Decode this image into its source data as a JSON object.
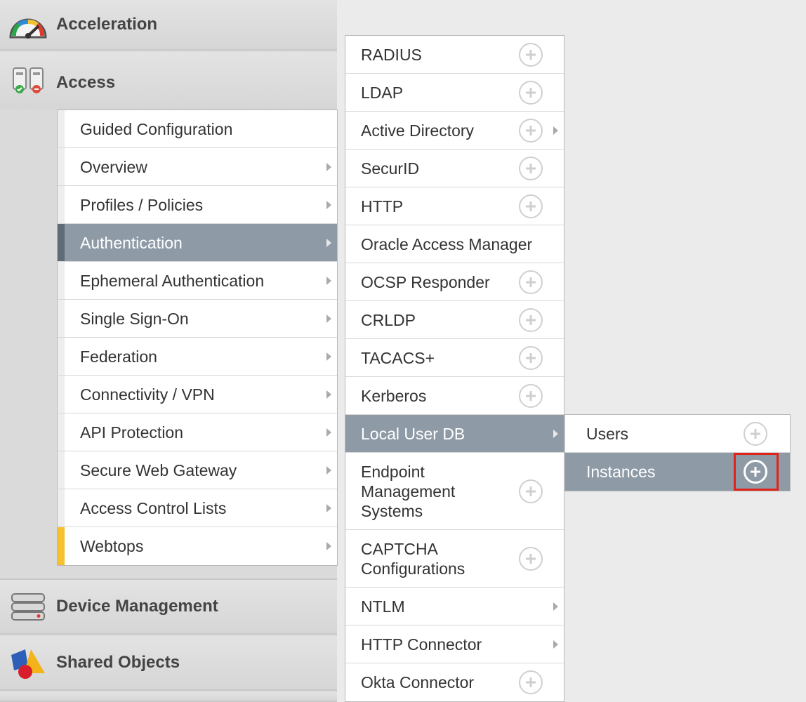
{
  "nav": {
    "acceleration": "Acceleration",
    "access": "Access",
    "device_management": "Device Management",
    "shared_objects": "Shared Objects"
  },
  "access_menu": {
    "items": [
      {
        "label": "Guided Configuration"
      },
      {
        "label": "Overview"
      },
      {
        "label": "Profiles / Policies"
      },
      {
        "label": "Authentication"
      },
      {
        "label": "Ephemeral Authentication"
      },
      {
        "label": "Single Sign-On"
      },
      {
        "label": "Federation"
      },
      {
        "label": "Connectivity / VPN"
      },
      {
        "label": "API Protection"
      },
      {
        "label": "Secure Web Gateway"
      },
      {
        "label": "Access Control Lists"
      },
      {
        "label": "Webtops"
      }
    ],
    "active": "Authentication"
  },
  "authentication_menu": {
    "items": [
      {
        "label": "RADIUS"
      },
      {
        "label": "LDAP"
      },
      {
        "label": "Active Directory"
      },
      {
        "label": "SecurID"
      },
      {
        "label": "HTTP"
      },
      {
        "label": "Oracle Access Manager"
      },
      {
        "label": "OCSP Responder"
      },
      {
        "label": "CRLDP"
      },
      {
        "label": "TACACS+"
      },
      {
        "label": "Kerberos"
      },
      {
        "label": "Local User DB"
      },
      {
        "label": "Endpoint Management Systems"
      },
      {
        "label": "CAPTCHA Configurations"
      },
      {
        "label": "NTLM"
      },
      {
        "label": "HTTP Connector"
      },
      {
        "label": "Okta Connector"
      }
    ],
    "active": "Local User DB"
  },
  "local_user_db_menu": {
    "items": [
      {
        "label": "Users"
      },
      {
        "label": "Instances"
      }
    ],
    "active": "Instances"
  },
  "colors": {
    "active_bg": "#8e9aa6",
    "highlight": "#e2231a",
    "webtops_accent": "#f6c12f"
  }
}
